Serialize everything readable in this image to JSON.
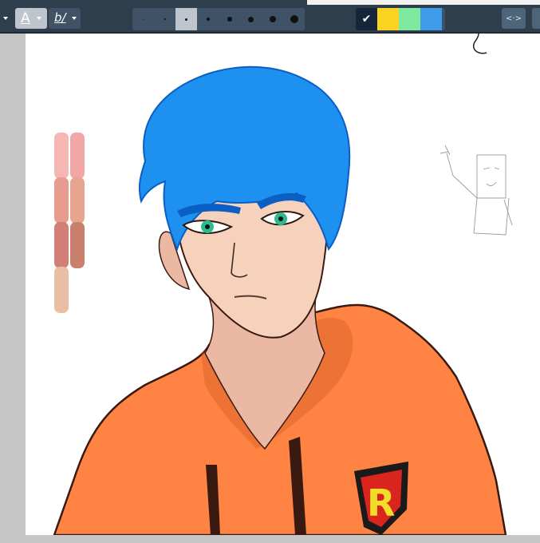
{
  "toolbar": {
    "font_button": "A",
    "brush_button": "b/",
    "brush_sizes": [
      {
        "name": "size-1",
        "dot": 1,
        "active": false
      },
      {
        "name": "size-2",
        "dot": 2,
        "active": false
      },
      {
        "name": "size-3",
        "dot": 3,
        "active": true
      },
      {
        "name": "size-4",
        "dot": 4,
        "active": false
      },
      {
        "name": "size-5",
        "dot": 6,
        "active": false
      },
      {
        "name": "size-6",
        "dot": 7,
        "active": false
      },
      {
        "name": "size-7",
        "dot": 8,
        "active": false
      },
      {
        "name": "size-8",
        "dot": 10,
        "active": false
      }
    ],
    "colors": [
      {
        "name": "navy",
        "hex": "#15253a",
        "selected": true
      },
      {
        "name": "yellow",
        "hex": "#f9d423",
        "selected": false
      },
      {
        "name": "green",
        "hex": "#7ee89e",
        "selected": false
      },
      {
        "name": "blue",
        "hex": "#3e9bea",
        "selected": false
      }
    ],
    "check_glyph": "✔",
    "expand_glyph": "<·>"
  },
  "canvas": {
    "emblem_letter": "R",
    "colors": {
      "hair": "#1e90f0",
      "hair_dark": "#0b5fc4",
      "skin": "#f6d2bd",
      "skin_shadow": "#eab8a3",
      "hoodie": "#ff8443",
      "hoodie_dark": "#c9531c",
      "outline": "#3a1a10",
      "emblem_red": "#d9251d",
      "emblem_yellow": "#f3dd2b",
      "eye": "#2dbb8e"
    },
    "palette_swatches": [
      "#f6b6b3",
      "#f1a7a5",
      "#e79c8f",
      "#e8a690",
      "#d27f77",
      "#c9806c",
      "#e9bfa4"
    ]
  }
}
